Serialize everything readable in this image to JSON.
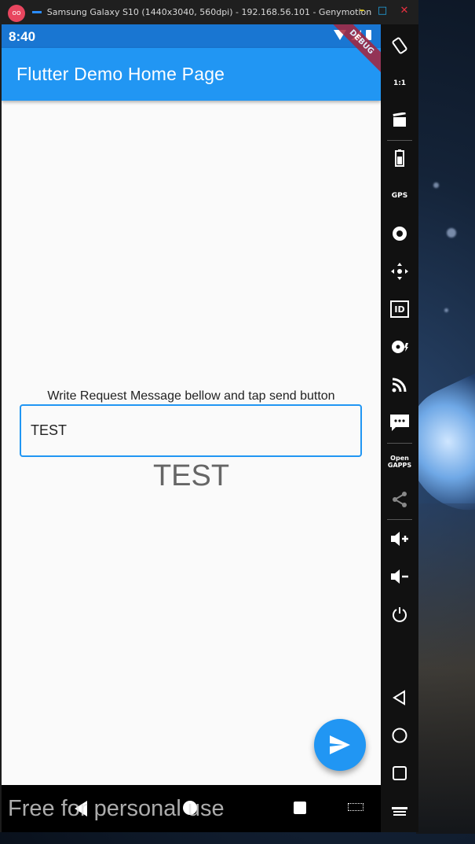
{
  "emulator": {
    "title": "Samsung Galaxy S10 (1440x3040, 560dpi) - 192.168.56.101 - Genymotion",
    "logo_text": "oo",
    "minimize": "–",
    "maximize": "□",
    "close": "✕"
  },
  "status_bar": {
    "time": "8:40",
    "icons": [
      "wifi-icon",
      "signal-icon",
      "battery-icon"
    ]
  },
  "app_bar": {
    "title": "Flutter Demo Home Page",
    "debug_banner": "DEBUG",
    "color": "#2196f3",
    "status_color": "#1976d2"
  },
  "body": {
    "prompt": "Write Request Message bellow and tap send button",
    "input_value": "TEST",
    "response": "TEST"
  },
  "fab": {
    "icon": "send-icon",
    "color": "#2196f3"
  },
  "nav_bar": {
    "icons": [
      "back-icon",
      "home-icon",
      "recents-icon",
      "keyboard-icon"
    ]
  },
  "watermark": "Free for personal use",
  "toolbar": {
    "icons": [
      "rotate-icon",
      "pixel-perfect-icon",
      "capture-icon",
      "battery-icon",
      "gps-icon",
      "camera-icon",
      "remote-control-icon",
      "identifiers-icon",
      "disk-io-icon",
      "cast-icon",
      "sms-icon",
      "open-gapps-icon",
      "share-icon",
      "volume-up-icon",
      "volume-down-icon",
      "power-icon",
      "back-icon",
      "home-icon",
      "recents-icon",
      "menu-icon"
    ],
    "labels": {
      "gps": "GPS",
      "identifiers": "ID",
      "pixel_perfect": "1:1",
      "open_gapps": "Open\nGAPPS"
    }
  }
}
